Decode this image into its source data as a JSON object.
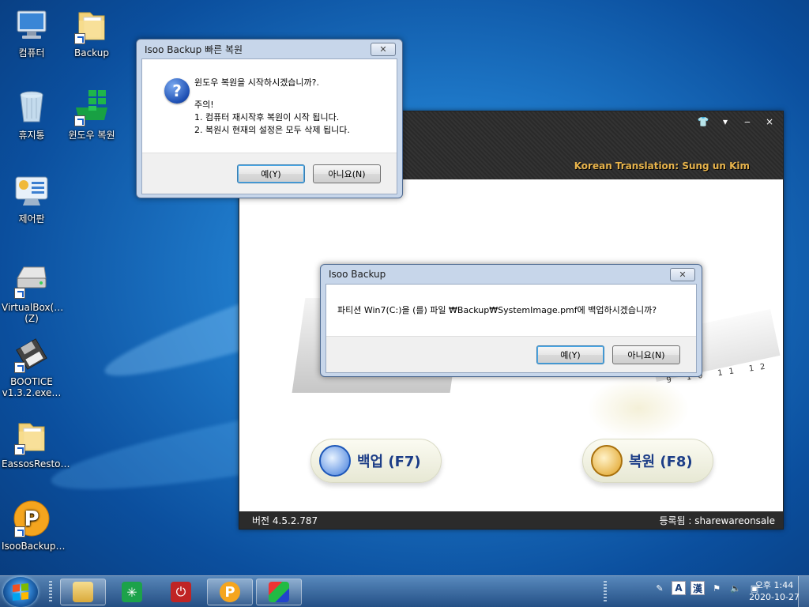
{
  "desktop": {
    "icons": [
      {
        "label": "컴퓨터"
      },
      {
        "label": "Backup"
      },
      {
        "label": "휴지통"
      },
      {
        "label": "윈도우 복원"
      },
      {
        "label": "제어판"
      },
      {
        "label": "VirtualBox(…",
        "label2": "(Z)"
      },
      {
        "label": "BOOTICE",
        "label2": "v1.3.2.exe…"
      },
      {
        "label": "EassosResto…"
      },
      {
        "label": "IsooBackup…"
      }
    ]
  },
  "isoo_window": {
    "translation_credit": "Korean Translation: Sung un Kim",
    "controls": {
      "skin": "👕",
      "menu": "▾",
      "minimize": "‒",
      "close": "×"
    },
    "backup_label": "백업 (F7)",
    "restore_label": "복원 (F8)",
    "ruler_numbers": "9 10 11 12",
    "version": "버전 4.5.2.787",
    "registered": "등록됨 : sharewareonsale"
  },
  "dialog_restore": {
    "title": "Isoo Backup 빠른 복원",
    "close_glyph": "✕",
    "icon_glyph": "?",
    "line1": "윈도우 복원을 시작하시겠습니까?.",
    "line2": "주의!",
    "line3": "1. 컴퓨터 재시작후 복원이 시작 됩니다.",
    "line4": "2. 복원시 현재의 설정은 모두 삭제 됩니다.",
    "yes": "예(Y)",
    "no": "아니요(N)"
  },
  "dialog_backup": {
    "title": "Isoo Backup",
    "close_glyph": "✕",
    "message": "파티션 Win7(C:)을 (를) 파일 ₩Backup₩SystemImage.pmf에 백업하시겠습니까?",
    "yes": "예(Y)",
    "no": "아니요(N)"
  },
  "taskbar": {
    "apps": [
      "file-explorer",
      "green-app",
      "red-app",
      "isoo-backup",
      "bootice"
    ],
    "tray": {
      "ime_a": "A",
      "ime_han": "漢"
    },
    "clock_time": "오후 1:44",
    "clock_date": "2020-10-27"
  }
}
